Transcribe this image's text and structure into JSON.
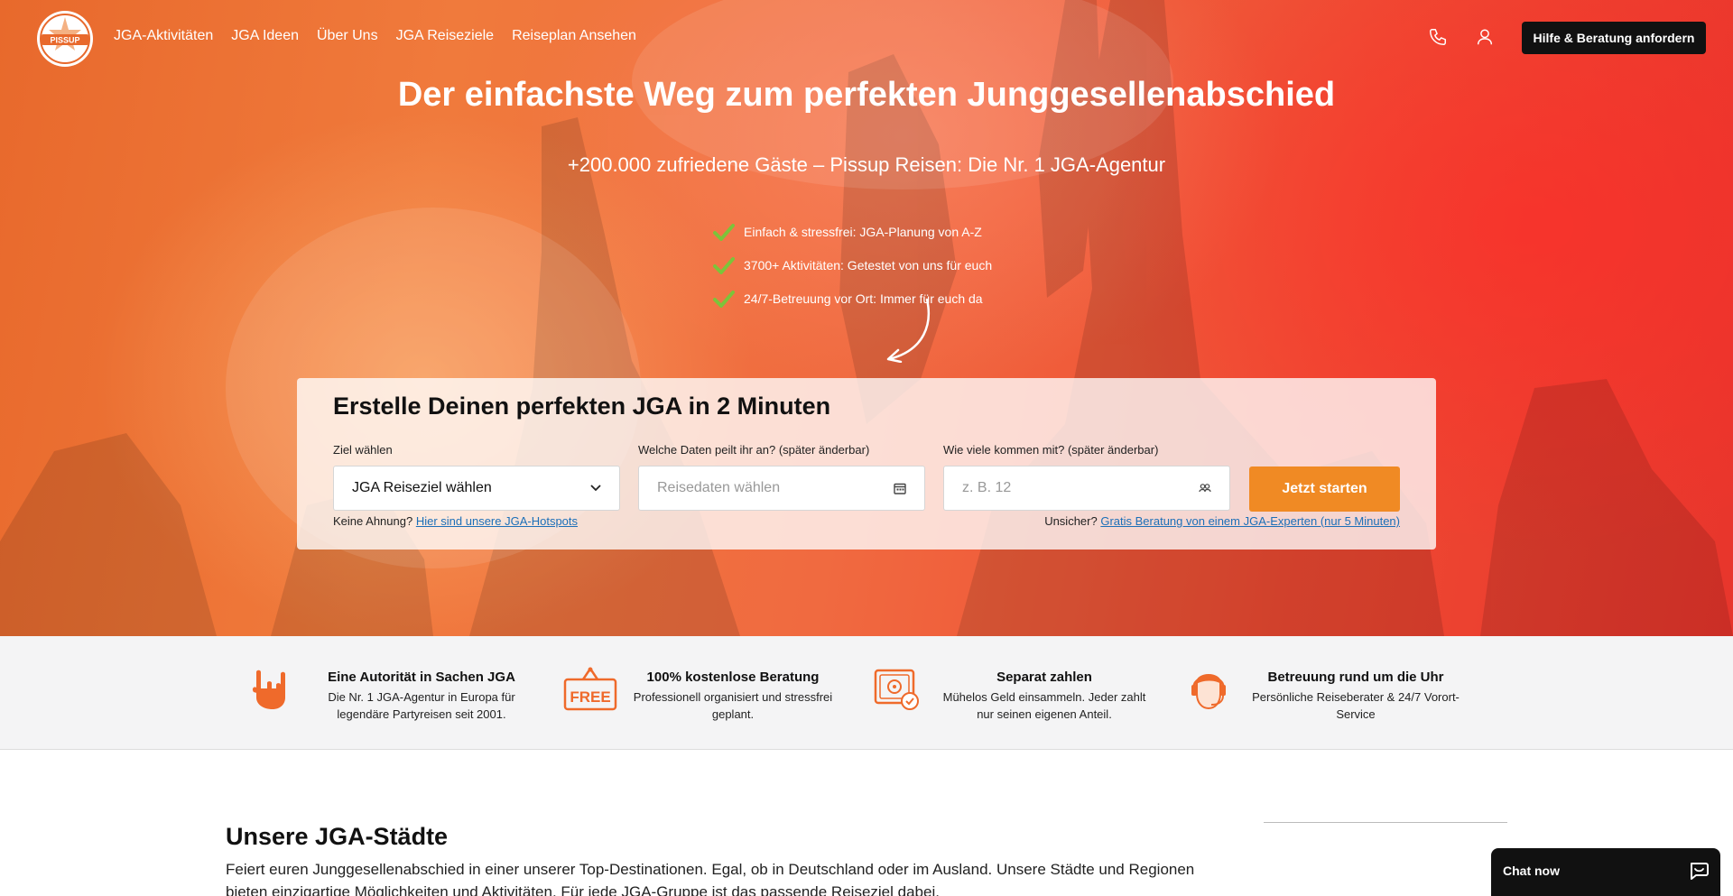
{
  "nav": {
    "logo_text": "PISSUP",
    "links": [
      "JGA-Aktivitäten",
      "JGA Ideen",
      "Über Uns",
      "JGA Reiseziele",
      "Reiseplan Ansehen"
    ],
    "phone_icon": "phone-icon",
    "account_icon": "user-icon",
    "cta_label": "Hilfe & Beratung anfordern"
  },
  "hero": {
    "headline": "Der einfachste Weg zum perfekten Junggesellenabschied",
    "subline": "+200.000 zufriedene Gäste – Pissup Reisen: Die Nr. 1 JGA-Agentur",
    "bullets": [
      "Einfach & stressfrei: JGA-Planung von A-Z",
      "3700+ Aktivitäten: Getestet von uns für euch",
      "24/7-Betreuung vor Ort: Immer für euch da"
    ]
  },
  "search": {
    "title": "Erstelle Deinen perfekten JGA in 2 Minuten",
    "destination_label": "Ziel wählen",
    "destination_value": "JGA Reiseziel wählen",
    "dates_label": "Welche Daten peilt ihr an? (später änderbar)",
    "dates_placeholder": "Reisedaten wählen",
    "group_label": "Wie viele kommen mit? (später änderbar)",
    "group_placeholder": "z. B. 12",
    "start_label": "Jetzt starten",
    "hint_left_prefix": "Keine Ahnung?",
    "hint_left_link": "Hier sind unsere JGA-Hotspots",
    "hint_right_prefix": "Unsicher?",
    "hint_right_link": "Gratis Beratung von einem JGA-Experten (nur 5 Minuten)"
  },
  "features": [
    {
      "icon": "rock-hand-icon",
      "title": "Eine Autorität in Sachen JGA",
      "desc": "Die Nr. 1 JGA-Agentur in Europa für legendäre Partyreisen seit 2001."
    },
    {
      "icon": "free-tag-icon",
      "icon_text": "FREE",
      "title": "100% kostenlose Beratung",
      "desc": "Professionell organisiert und stressfrei geplant."
    },
    {
      "icon": "safe-icon",
      "title": "Separat zahlen",
      "desc": "Mühelos Geld einsammeln. Jeder zahlt nur seinen eigenen Anteil."
    },
    {
      "icon": "support-agent-icon",
      "title": "Betreuung rund um die Uhr",
      "desc": "Persönliche Reiseberater & 24/7 Vorort-Service"
    }
  ],
  "cities": {
    "title": "Unsere JGA-Städte",
    "text": "Feiert euren Junggesellenabschied in einer unserer Top-Destinationen. Egal, ob in Deutschland oder im Ausland. Unsere Städte und Regionen bieten einzigartige Möglichkeiten und Aktivitäten. Für jede JGA-Gruppe ist das passende Reiseziel dabei."
  },
  "chat": {
    "label": "Chat now"
  },
  "colors": {
    "accent": "#f08a24",
    "dark": "#111111",
    "link": "#1c6fb8",
    "check": "#7cc43a"
  }
}
